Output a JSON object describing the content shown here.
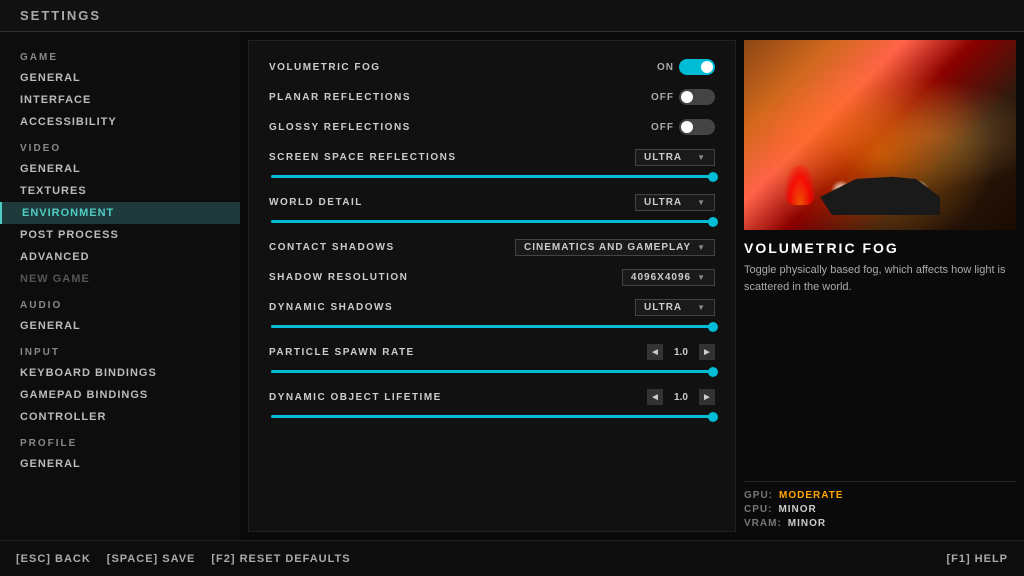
{
  "header": {
    "title": "SETTINGS"
  },
  "sidebar": {
    "sections": [
      {
        "label": "GAME",
        "items": [
          {
            "id": "game-general",
            "label": "GENERAL",
            "active": false
          },
          {
            "id": "game-interface",
            "label": "INTERFACE",
            "active": false
          },
          {
            "id": "game-accessibility",
            "label": "ACCESSIBILITY",
            "active": false
          }
        ]
      },
      {
        "label": "VIDEO",
        "items": [
          {
            "id": "video-general",
            "label": "GENERAL",
            "active": false
          },
          {
            "id": "video-textures",
            "label": "TEXTURES",
            "active": false
          },
          {
            "id": "video-environment",
            "label": "ENVIRONMENT",
            "active": true
          },
          {
            "id": "video-postprocess",
            "label": "POST PROCESS",
            "active": false
          },
          {
            "id": "video-advanced",
            "label": "ADVANCED",
            "active": false
          },
          {
            "id": "video-newgame",
            "label": "NEW GAME",
            "active": false,
            "dim": true
          }
        ]
      },
      {
        "label": "AUDIO",
        "items": [
          {
            "id": "audio-general",
            "label": "GENERAL",
            "active": false
          }
        ]
      },
      {
        "label": "INPUT",
        "items": [
          {
            "id": "input-keyboard",
            "label": "KEYBOARD BINDINGS",
            "active": false
          },
          {
            "id": "input-gamepad",
            "label": "GAMEPAD BINDINGS",
            "active": false
          },
          {
            "id": "input-controller",
            "label": "CONTROLLER",
            "active": false
          }
        ]
      },
      {
        "label": "PROFILE",
        "items": [
          {
            "id": "profile-general",
            "label": "GENERAL",
            "active": false
          }
        ]
      }
    ]
  },
  "settings": {
    "rows": [
      {
        "id": "volumetric-fog",
        "label": "VOLUMETRIC FOG",
        "control_type": "toggle",
        "value": "ON",
        "state": "on"
      },
      {
        "id": "planar-reflections",
        "label": "PLANAR REFLECTIONS",
        "control_type": "toggle",
        "value": "OFF",
        "state": "off"
      },
      {
        "id": "glossy-reflections",
        "label": "GLOSSY REFLECTIONS",
        "control_type": "toggle",
        "value": "OFF",
        "state": "off"
      },
      {
        "id": "screen-space-reflections",
        "label": "SCREEN SPACE REFLECTIONS",
        "control_type": "dropdown",
        "value": "ULTRA",
        "has_slider": true,
        "slider_pct": 100
      },
      {
        "id": "world-detail",
        "label": "WORLD DETAIL",
        "control_type": "dropdown",
        "value": "ULTRA",
        "has_slider": true,
        "slider_pct": 100
      },
      {
        "id": "contact-shadows",
        "label": "CONTACT SHADOWS",
        "control_type": "dropdown",
        "value": "CINEMATICS AND GAMEPLAY",
        "wide": true
      },
      {
        "id": "shadow-resolution",
        "label": "SHADOW RESOLUTION",
        "control_type": "dropdown",
        "value": "4096X4096"
      },
      {
        "id": "dynamic-shadows",
        "label": "DYNAMIC SHADOWS",
        "control_type": "dropdown",
        "value": "ULTRA",
        "has_slider": true,
        "slider_pct": 100
      },
      {
        "id": "particle-spawn-rate",
        "label": "PARTICLE SPAWN RATE",
        "control_type": "stepper",
        "value": "1.0",
        "has_slider": true,
        "slider_pct": 100
      },
      {
        "id": "dynamic-object-lifetime",
        "label": "DYNAMIC OBJECT LIFETIME",
        "control_type": "stepper",
        "value": "1.0",
        "has_slider": true,
        "slider_pct": 100
      }
    ]
  },
  "preview": {
    "title": "VOLUMETRIC FOG",
    "description": "Toggle physically based fog, which affects how light is scattered in the world.",
    "performance": {
      "gpu_label": "GPU:",
      "gpu_value": "MODERATE",
      "cpu_label": "CPU:",
      "cpu_value": "MINOR",
      "vram_label": "VRAM:",
      "vram_value": "MINOR"
    }
  },
  "footer": {
    "back": "[ESC] BACK",
    "save": "[SPACE] SAVE",
    "reset": "[F2] RESET DEFAULTS",
    "help": "[F1] HELP"
  }
}
